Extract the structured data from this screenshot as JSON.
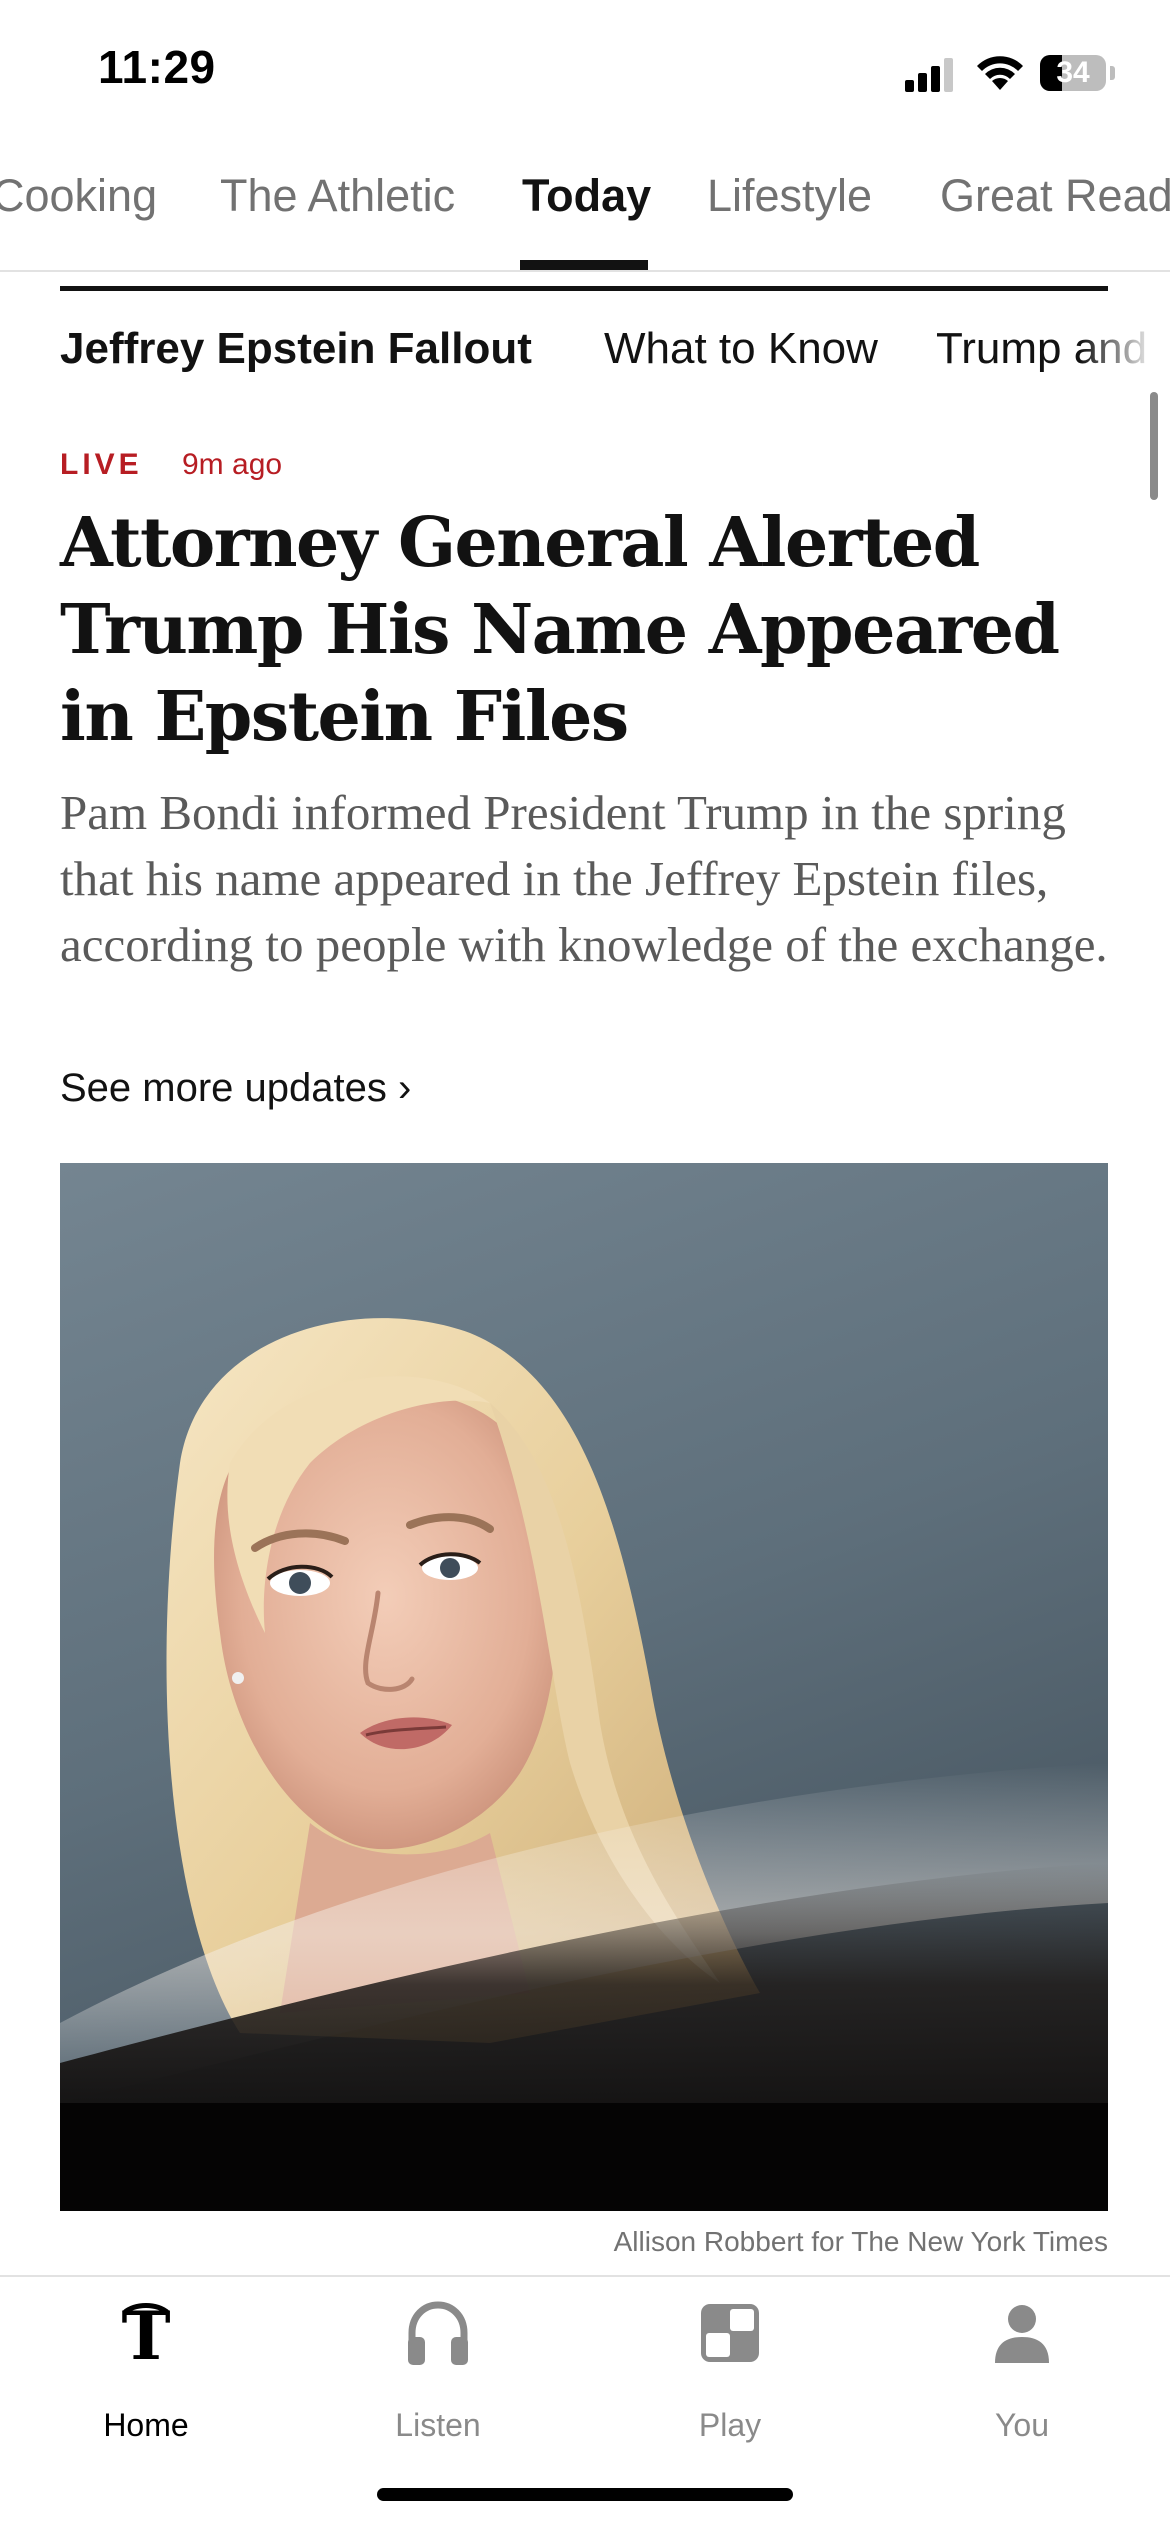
{
  "status_bar": {
    "time": "11:29",
    "battery_percent": "34",
    "battery_level": 0.34,
    "signal_bars": 3,
    "icons": [
      "cellular-signal-icon",
      "wifi-icon",
      "battery-icon"
    ]
  },
  "section_tabs": [
    "Cooking",
    "The Athletic",
    "Today",
    "Lifestyle",
    "Great Read"
  ],
  "active_section_tab": "Today",
  "topic_subtabs": [
    "Jeffrey Epstein Fallout",
    "What to Know",
    "Trump and"
  ],
  "article": {
    "live_label": "LIVE",
    "timestamp": "9m ago",
    "headline": "Attorney General Alerted Trump His Name Appeared in Epstein Files",
    "summary": "Pam Bondi informed President Trump in the spring that his name appeared in the Jeffrey Epstein files, according to people with knowledge of the exchange.",
    "see_more": "See more updates ›",
    "photo_credit": "Allison Robbert for The New York Times"
  },
  "tab_bar": {
    "items": [
      {
        "label": "Home",
        "icon": "nyt-t-logo-icon",
        "active": true
      },
      {
        "label": "Listen",
        "icon": "headphones-icon",
        "active": false
      },
      {
        "label": "Play",
        "icon": "games-grid-icon",
        "active": false
      },
      {
        "label": "You",
        "icon": "person-icon",
        "active": false
      }
    ]
  },
  "colors": {
    "live_red": "#b71d23",
    "text_primary": "#121212",
    "text_secondary": "#727272",
    "summary_gray": "#5a5a5a"
  }
}
